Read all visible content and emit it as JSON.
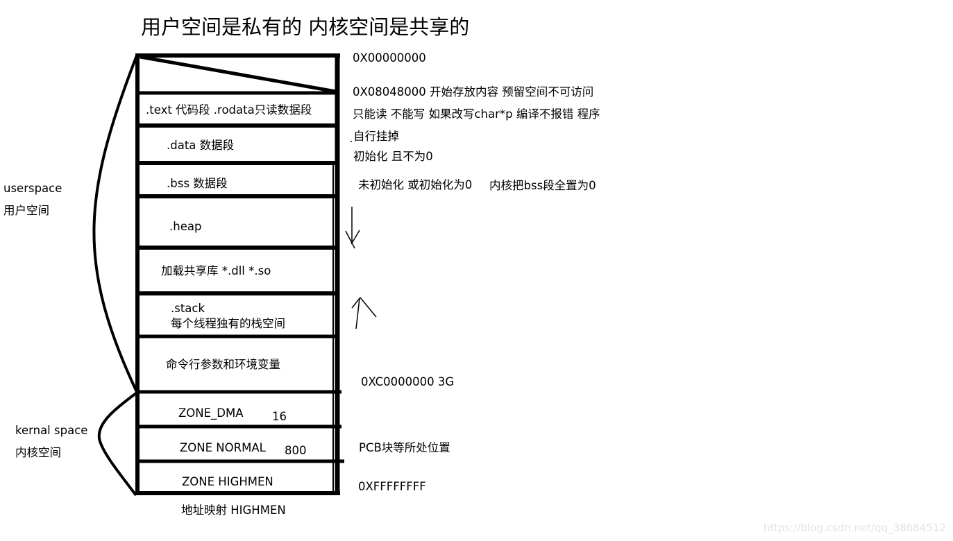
{
  "title": "用户空间是私有的 内核空间是共享的",
  "side_labels": {
    "userspace_en": "userspace",
    "userspace_cn": "用户空间",
    "kernelspace_en": "kernal space",
    "kernelspace_cn": "内核空间"
  },
  "segments": [
    {
      "id": "reserved",
      "label": ""
    },
    {
      "id": "text",
      "label": ".text 代码段   .rodata只读数据段"
    },
    {
      "id": "data",
      "label": ".data  数据段"
    },
    {
      "id": "bss",
      "label": ".bss 数据段"
    },
    {
      "id": "heap",
      "label": ".heap"
    },
    {
      "id": "shared-lib",
      "label": "加载共享库 *.dll *.so"
    },
    {
      "id": "stack",
      "label": ".stack",
      "sublabel": "每个线程独有的栈空间"
    },
    {
      "id": "args-env",
      "label": "命令行参数和环境变量"
    },
    {
      "id": "zone-dma",
      "label": "ZONE_DMA",
      "size": "16"
    },
    {
      "id": "zone-normal",
      "label": "ZONE  NORMAL",
      "size": "800"
    },
    {
      "id": "zone-highmem",
      "label": "ZONE  HIGHMEN"
    }
  ],
  "below_label": "地址映射 HIGHMEN",
  "annotations": {
    "addr_start": "0X00000000",
    "addr_text_start": "0X08048000 开始存放内容   预留空间不可访问",
    "text_note_1": "只能读 不能写 如果改写char*p 编译不报错 程序",
    "text_note_2": "自行挂掉",
    "data_note": "初始化 且不为0",
    "bss_note_1": "未初始化 或初始化为0",
    "bss_note_2": "内核把bss段全置为0",
    "addr_kernel": "0XC0000000   3G",
    "pcb_note": "PCB块等所处位置",
    "addr_end": "0XFFFFFFFF"
  },
  "arrows": {
    "heap_direction": "down",
    "stack_direction": "up"
  },
  "watermark": "https://blog.csdn.net/qq_38684512"
}
